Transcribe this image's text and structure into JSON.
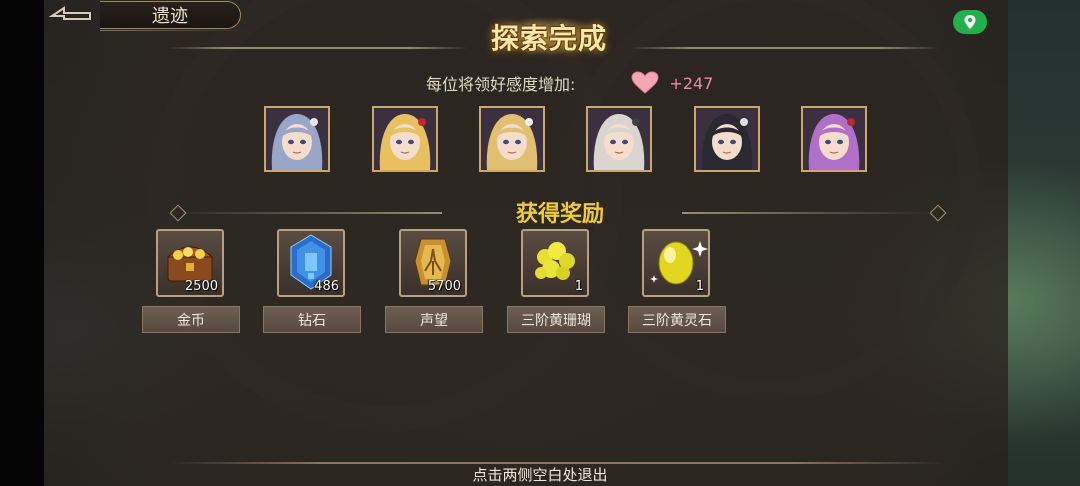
{
  "header": {
    "location_title": "遗迹",
    "banner": "探索完成",
    "affinity_label": "每位将领好感度增加:",
    "affinity_gain": "+247"
  },
  "characters": [
    {
      "name": "portrait-1",
      "hair": "#9aa6c8",
      "accent": "#e8e8f0"
    },
    {
      "name": "portrait-2",
      "hair": "#e8c060",
      "accent": "#c02828"
    },
    {
      "name": "portrait-3",
      "hair": "#e0c070",
      "accent": "#f0f0f0"
    },
    {
      "name": "portrait-4",
      "hair": "#d8d4d0",
      "accent": "#404040"
    },
    {
      "name": "portrait-5",
      "hair": "#2a2830",
      "accent": "#e0e0e8"
    },
    {
      "name": "portrait-6",
      "hair": "#b070c8",
      "accent": "#c02830"
    }
  ],
  "rewards_title": "获得奖励",
  "rewards": [
    {
      "label": "金币",
      "count": "2500",
      "icon": "treasure-chest-icon"
    },
    {
      "label": "钻石",
      "count": "486",
      "icon": "diamond-crystal-icon"
    },
    {
      "label": "声望",
      "count": "5700",
      "icon": "reputation-badge-icon"
    },
    {
      "label": "三阶黄珊瑚",
      "count": "1",
      "icon": "yellow-coral-icon"
    },
    {
      "label": "三阶黄灵石",
      "count": "1",
      "icon": "yellow-spirit-stone-icon"
    }
  ],
  "footer": {
    "hint": "点击两侧空白处退出"
  },
  "colors": {
    "banner": "#fbe7a8",
    "rewards_title": "#f2cb3a",
    "affinity_gain": "#f08a9a",
    "map_button": "#22b04c"
  }
}
